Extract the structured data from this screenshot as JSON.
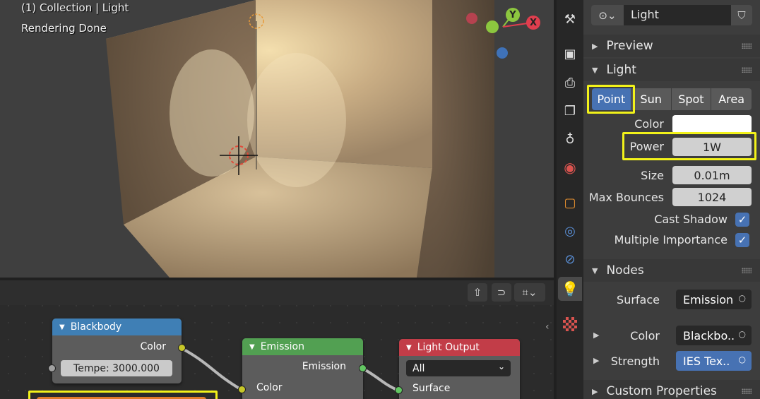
{
  "viewport": {
    "overlay_line1": "(1) Collection | Light",
    "overlay_line2": "Rendering Done",
    "gizmo_y": "Y",
    "gizmo_x": "X"
  },
  "node_editor": {
    "nodes": {
      "blackbody": {
        "title": "Blackbody",
        "output_color": "Color",
        "temperature_field": "Tempe: 3000.000"
      },
      "emission": {
        "title": "Emission",
        "output_emission": "Emission",
        "input_color": "Color"
      },
      "light_output": {
        "title": "Light Output",
        "target": "All",
        "input_surface": "Surface"
      }
    },
    "colors": {
      "blackbody_header": "#3f7fb5",
      "emission_header": "#52a052",
      "output_header": "#c23d48"
    }
  },
  "properties": {
    "datablock": {
      "name": "Light"
    },
    "sections": {
      "preview": "Preview",
      "light": "Light",
      "nodes": "Nodes",
      "custom": "Custom Properties"
    },
    "light_types": [
      "Point",
      "Sun",
      "Spot",
      "Area"
    ],
    "selected_light_type": "Point",
    "labels": {
      "color": "Color",
      "power": "Power",
      "size": "Size",
      "max_bounces": "Max Bounces",
      "cast_shadow": "Cast Shadow",
      "multiple_importance": "Multiple Importance",
      "surface": "Surface",
      "node_color": "Color",
      "strength": "Strength"
    },
    "values": {
      "power": "1W",
      "size": "0.01m",
      "max_bounces": "1024",
      "cast_shadow": true,
      "multiple_importance": true,
      "surface": "Emission",
      "node_color": "Blackbo..",
      "strength": "IES Tex.."
    },
    "accent_color": "#4772b3",
    "highlight_color": "#f2f21a"
  }
}
